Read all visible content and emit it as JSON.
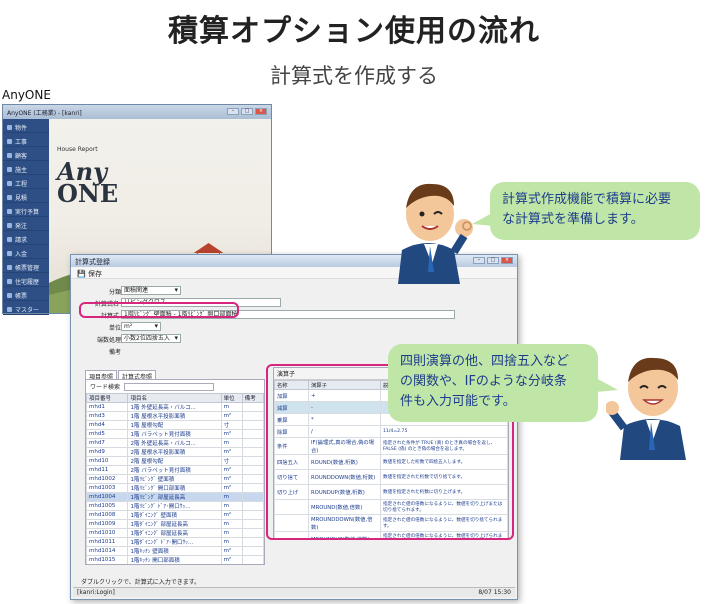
{
  "title": "積算オプション使用の流れ",
  "subtitle": "計算式を作成する",
  "app_label": "AnyONE",
  "anyone_window": {
    "title": "AnyONE (工務業) - [kanri]",
    "logo": {
      "brand": "House Report",
      "line1": "Any",
      "line2": "ONE"
    },
    "sidebar": [
      "物件",
      "工事",
      "顧客",
      "施主",
      "工程",
      "見積",
      "実行予算",
      "発注",
      "請求",
      "入金",
      "帳票管理",
      "住宅履歴",
      "帳票",
      "マスター"
    ]
  },
  "calc_window": {
    "title": "計算式登録",
    "toolbar_save": "保存",
    "fields": {
      "category_label": "分類",
      "category_value": "面積関連",
      "name_label": "計算式名",
      "name_value": "リビングクロス",
      "formula_label": "計算式",
      "formula_value": "1階ﾘﾋﾞﾝｸﾞ 壁面積 - 1階ﾘﾋﾞﾝｸﾞ 開口部面積",
      "unit_label": "単位",
      "unit_value": "m²",
      "rounding_label": "端数処理",
      "rounding_value": "小数2位四捨五入",
      "note_label": "備考"
    },
    "tabs": [
      "項目参照",
      "計算式参照"
    ],
    "word_search_label": "ワード検索",
    "item_columns": [
      "項目番号",
      "項目名",
      "単位",
      "備考"
    ],
    "items": [
      [
        "mhd1",
        "1階 外壁延長高・バルコ...",
        "m",
        ""
      ],
      [
        "mhd3",
        "1階 屋根水平投影面積",
        "m²",
        ""
      ],
      [
        "mhd4",
        "1階 屋根勾配",
        "寸",
        ""
      ],
      [
        "mhd5",
        "1階 バラペット見付面積",
        "m²",
        ""
      ],
      [
        "mhd7",
        "2階 外壁延長高・バルコ...",
        "m",
        ""
      ],
      [
        "mhd9",
        "2階 屋根水平投影面積",
        "m²",
        ""
      ],
      [
        "mhd10",
        "2階 屋根勾配",
        "寸",
        ""
      ],
      [
        "mhd11",
        "2階 バラペット見付面積",
        "m²",
        ""
      ],
      [
        "mhd1002",
        "1階ﾘﾋﾞﾝｸﾞ 壁面積",
        "m²",
        ""
      ],
      [
        "mhd1003",
        "1階ﾘﾋﾞﾝｸﾞ 開口部面積",
        "m²",
        ""
      ],
      [
        "mhd1004",
        "1階ﾘﾋﾞﾝｸﾞ 部屋延長高",
        "m",
        ""
      ],
      [
        "mhd1005",
        "1階ﾘﾋﾞﾝｸﾞ ﾄﾞｱ･開口ｻｯ...",
        "m",
        ""
      ],
      [
        "mhd1008",
        "1階ﾀﾞｲﾆﾝｸﾞ 壁面積",
        "m²",
        ""
      ],
      [
        "mhd1009",
        "1階ﾀﾞｲﾆﾝｸﾞ 部屋延長高",
        "m",
        ""
      ],
      [
        "mhd1010",
        "1階ﾀﾞｲﾆﾝｸﾞ 部屋延長高",
        "m",
        ""
      ],
      [
        "mhd1011",
        "1階ﾀﾞｲﾆﾝｸﾞ ﾄﾞｱ･開口ｻｯ...",
        "m",
        ""
      ],
      [
        "mhd1014",
        "1階ｷｯﾁﾝ 壁面積",
        "m²",
        ""
      ],
      [
        "mhd1015",
        "1階ｷｯﾁﾝ 開口部面積",
        "m²",
        ""
      ]
    ],
    "op_panel_title": "演算子",
    "op_columns": [
      "名称",
      "演算子",
      "説明"
    ],
    "ops": [
      [
        "加算",
        "+",
        ""
      ],
      [
        "減算",
        "-",
        ""
      ],
      [
        "乗算",
        "*",
        ""
      ],
      [
        "除算",
        "/",
        "11/4=2.75"
      ],
      [
        "条件",
        "IF(論理式,真の場合,偽の場合)",
        "指定された条件が TRUE (真) のとき真の場合を返し、FALSE (偽) のとき偽の場合を返します。"
      ],
      [
        "四捨五入",
        "ROUND(数値,桁数)",
        "数値を指定した桁数で四捨五入します。"
      ],
      [
        "切り捨て",
        "ROUNDDOWN(数値,桁数)",
        "数値を指定された桁数で切り捨てます。"
      ],
      [
        "切り上げ",
        "ROUNDUP(数値,桁数)",
        "数値を指定された桁数に切り上げます。"
      ],
      [
        "",
        "MROUND(数値,倍数)",
        "指定された値の倍数になるように、数値を切り上げまたは切り捨てられます。"
      ],
      [
        "",
        "MROUNDDOWN(数値,倍数)",
        "指定された値の倍数になるように、数値を切り捨てられます。"
      ],
      [
        "",
        "MROUNDUP(数値,倍数)",
        "指定された値の倍数になるように、数値を切り上げられます。"
      ]
    ],
    "hint": "ダブルクリックで、計算式に入力できます。",
    "status_left": "[kanri:Login]",
    "status_right": "8/07 15:30"
  },
  "bubble1": {
    "line1": "計算式作成機能で積算に必要",
    "line2": "な計算式を準備します。"
  },
  "bubble2": {
    "line1": "四則演算の他、四捨五入など",
    "line2": "の関数や、IFのような分岐条",
    "line3": "件も入力可能です。"
  },
  "colors": {
    "highlight": "#d6267e",
    "bubble": "#bfe6a6",
    "bubble_text": "#1d3b8c",
    "sidebar": "#2d4f86"
  }
}
